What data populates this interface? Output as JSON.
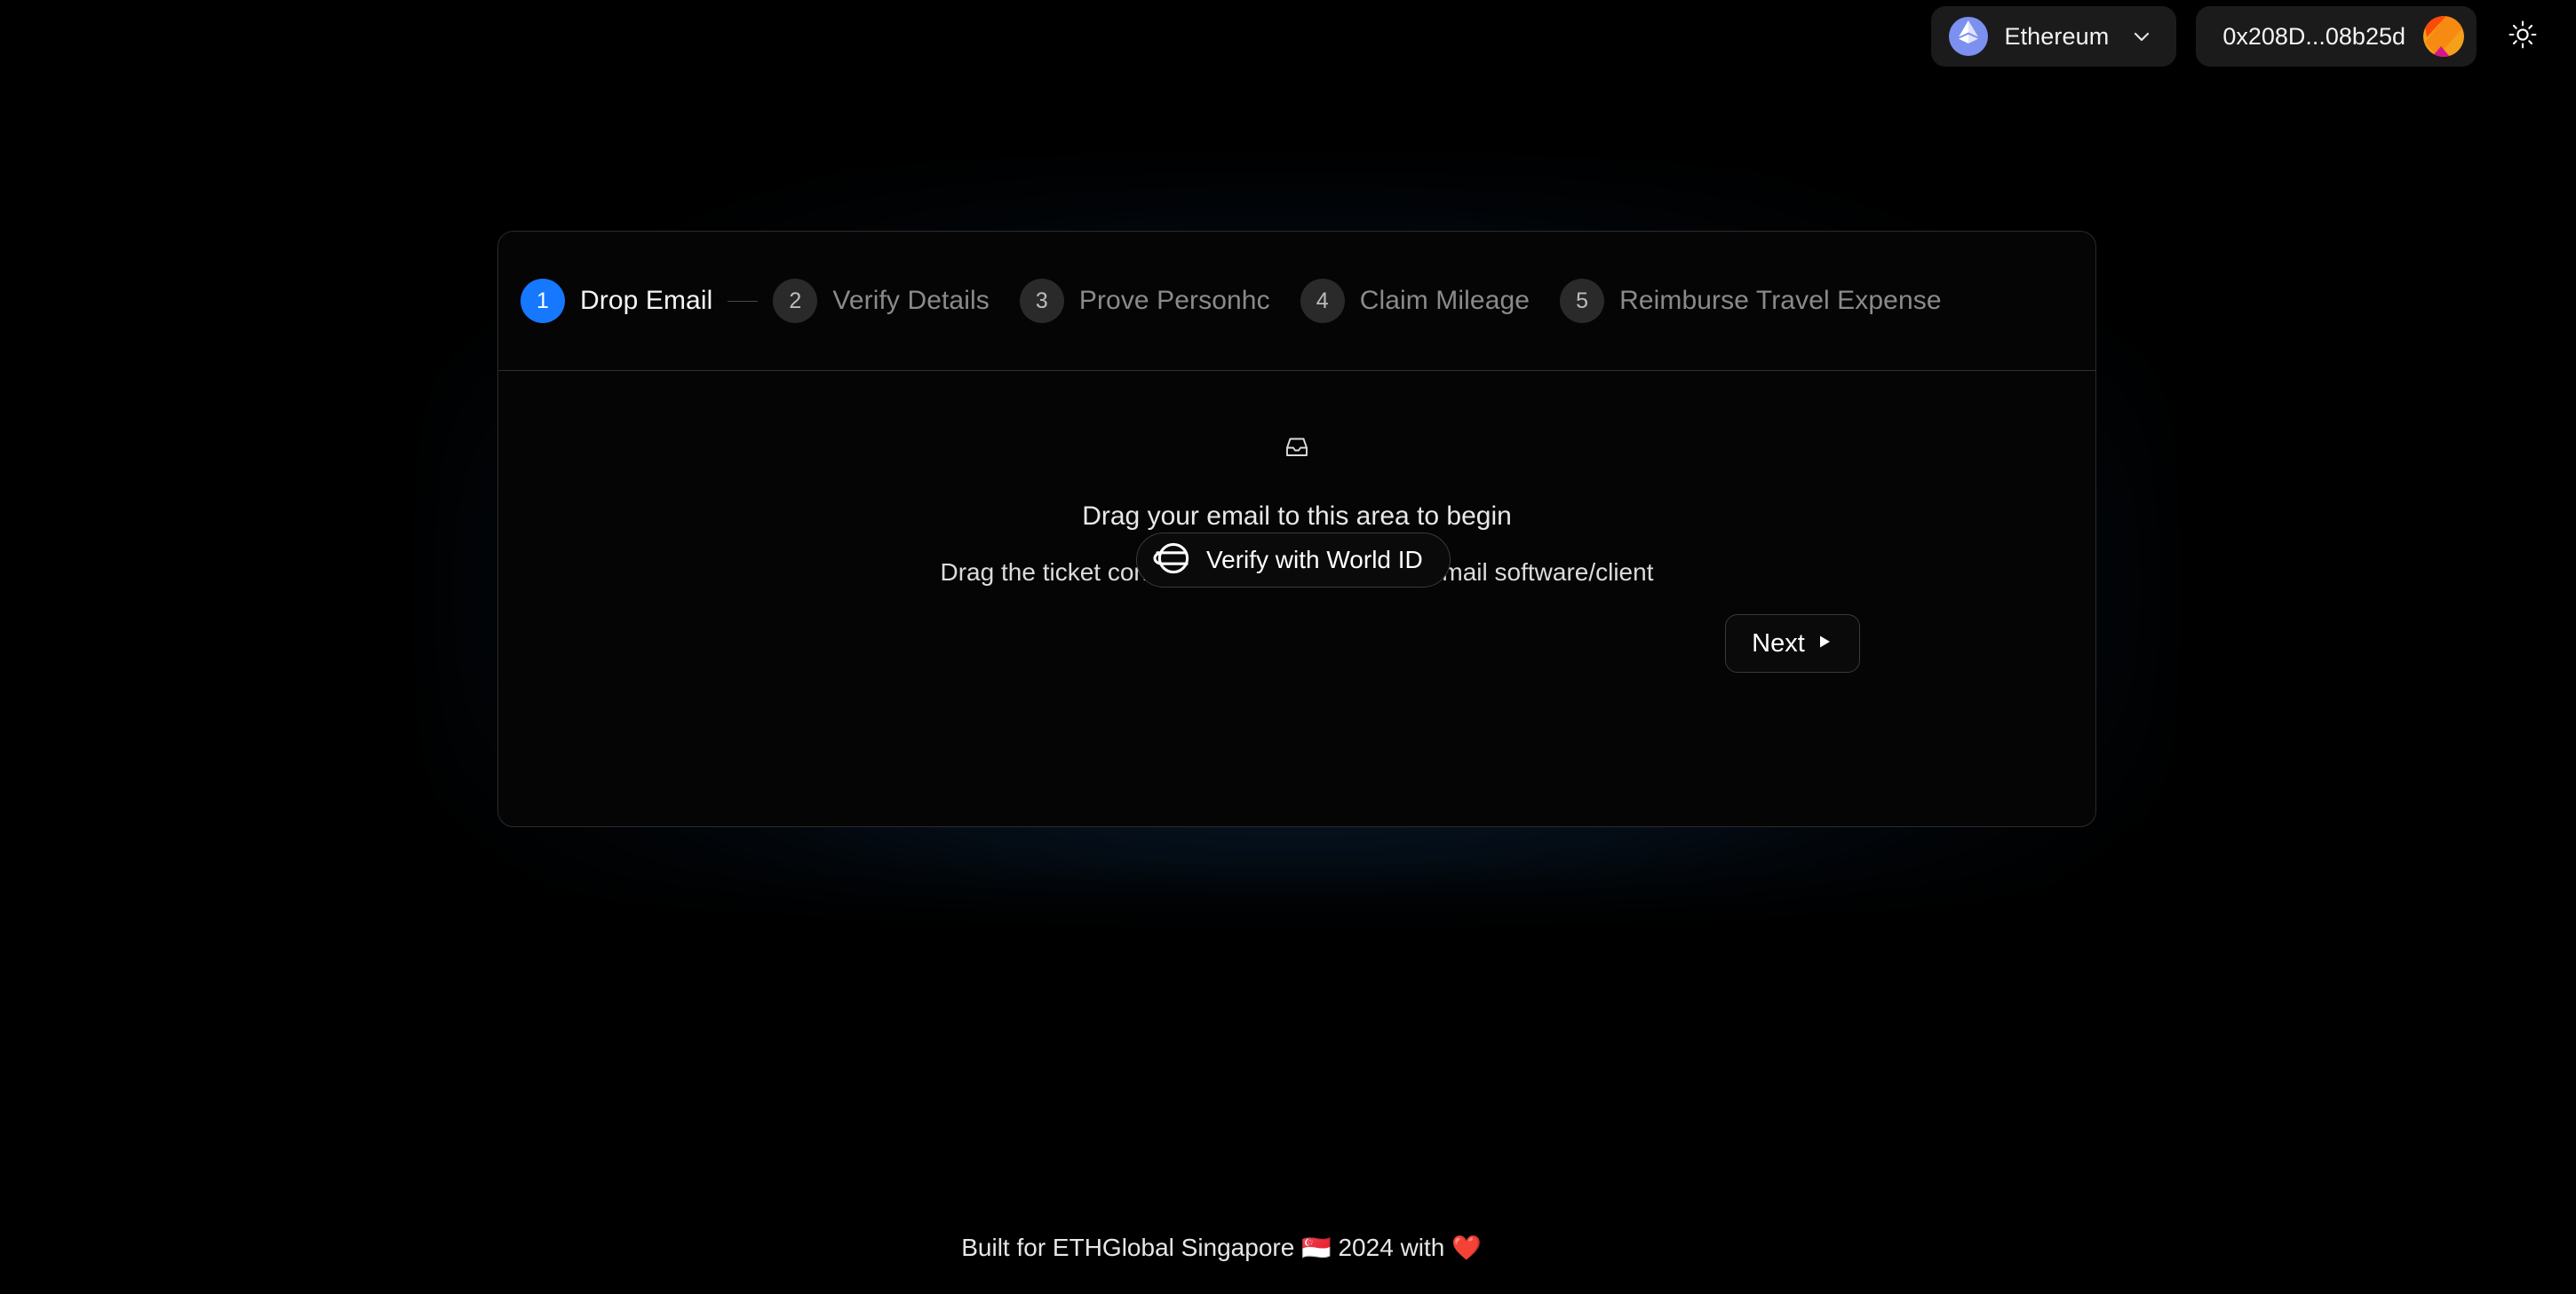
{
  "header": {
    "chain": {
      "name": "Ethereum",
      "icon": "ethereum-icon",
      "chevron": "chevron-down-icon"
    },
    "wallet": {
      "address": "0x208D...08b25d",
      "avatar": "wallet-avatar"
    },
    "theme_toggle": {
      "icon": "sun-icon"
    }
  },
  "stepper": {
    "steps": [
      {
        "number": "1",
        "label": "Drop Email",
        "active": true
      },
      {
        "number": "2",
        "label": "Verify Details",
        "active": false
      },
      {
        "number": "3",
        "label": "Prove Personhc",
        "active": false
      },
      {
        "number": "4",
        "label": "Claim Mileage",
        "active": false
      },
      {
        "number": "5",
        "label": "Reimburse Travel Expense",
        "active": false
      }
    ]
  },
  "dropzone": {
    "icon": "inbox-icon",
    "title": "Drag your email to this area to begin",
    "subtitle": "Drag the ticket confirmation email from your email software/client"
  },
  "worldid_button": {
    "label": "Verify with World ID",
    "icon": "world-id-icon"
  },
  "next_button": {
    "label": "Next",
    "icon": "play-triangle-icon"
  },
  "footer": {
    "text_before": "Built for ETHGlobal Singapore",
    "flag": "🇸🇬",
    "year": "2024",
    "text_after": "with",
    "heart": "❤️"
  },
  "colors": {
    "background": "#000000",
    "card": "#050505",
    "card_border": "#2b2b2d",
    "active_step": "#1677ff",
    "inactive_step": "#2a2a2a",
    "glow": "#184878",
    "ethereum_badge": "#7b90ef"
  }
}
